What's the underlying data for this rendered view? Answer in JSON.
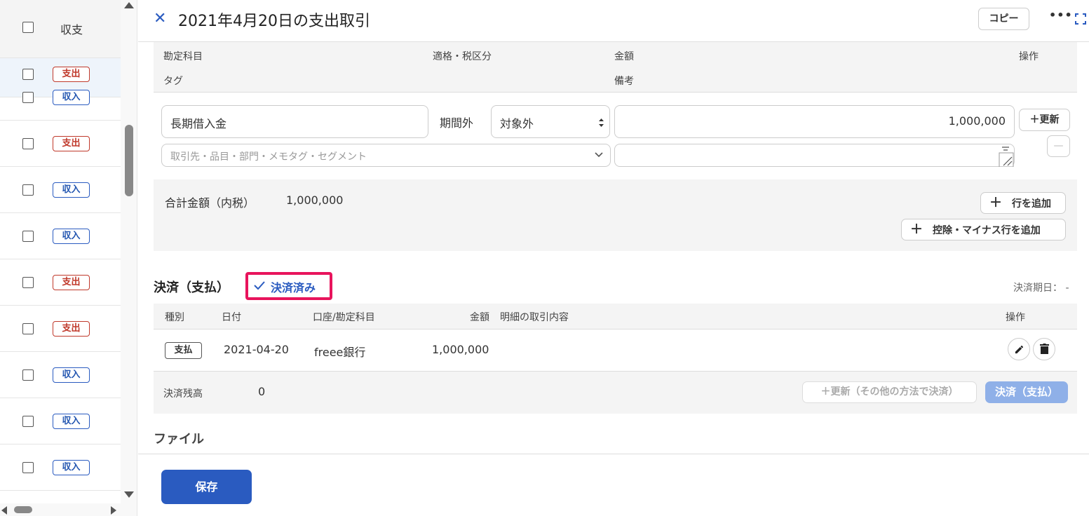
{
  "left_list": {
    "header_label": "収支",
    "rows": [
      {
        "type": "expense",
        "label": "支出"
      },
      {
        "type": "income",
        "label": "収入"
      },
      {
        "type": "expense",
        "label": "支出"
      },
      {
        "type": "income",
        "label": "収入"
      },
      {
        "type": "income",
        "label": "収入"
      },
      {
        "type": "expense",
        "label": "支出"
      },
      {
        "type": "expense",
        "label": "支出"
      },
      {
        "type": "income",
        "label": "収入"
      },
      {
        "type": "income",
        "label": "収入"
      },
      {
        "type": "income",
        "label": "収入"
      }
    ]
  },
  "header": {
    "title": "2021年4月20日の支出取引",
    "close_glyph": "✕",
    "copy_label": "コピー",
    "more_glyph": "•••"
  },
  "details": {
    "col_account": "勘定科目",
    "col_tax": "適格・税区分",
    "col_amount": "金額",
    "col_action": "操作",
    "col_tag": "タグ",
    "col_note": "備考",
    "row": {
      "account": "長期借入金",
      "period": "期間外",
      "tax": "対象外",
      "amount": "1,000,000",
      "tags_placeholder": "取引先・品目・部門・メモタグ・セグメント",
      "update_label": "＋更新",
      "remove_glyph": "—"
    },
    "total_label": "合計金額（内税）",
    "total_value": "1,000,000",
    "add_row_label": "行を追加",
    "add_minus_row_label": "控除・マイナス行を追加",
    "plus_glyph": "＋"
  },
  "settlement": {
    "title": "決済（支払）",
    "status": "決済済み",
    "due_label": "決済期日： -",
    "col_type": "種別",
    "col_date": "日付",
    "col_account": "口座/勘定科目",
    "col_amount": "金額",
    "col_desc": "明細の取引内容",
    "col_action": "操作",
    "row": {
      "type": "支払",
      "date": "2021-04-20",
      "account": "freee銀行",
      "amount": "1,000,000"
    },
    "balance_label": "決済残高",
    "balance_value": "0",
    "other_method_label": "＋更新（その他の方法で決済）",
    "pay_label": "決済（支払）"
  },
  "files": {
    "title": "ファイル"
  },
  "footer": {
    "save_label": "保存"
  },
  "colors": {
    "accent": "#2a5bc0",
    "expense": "#c0392b",
    "highlight": "#e8145c"
  }
}
